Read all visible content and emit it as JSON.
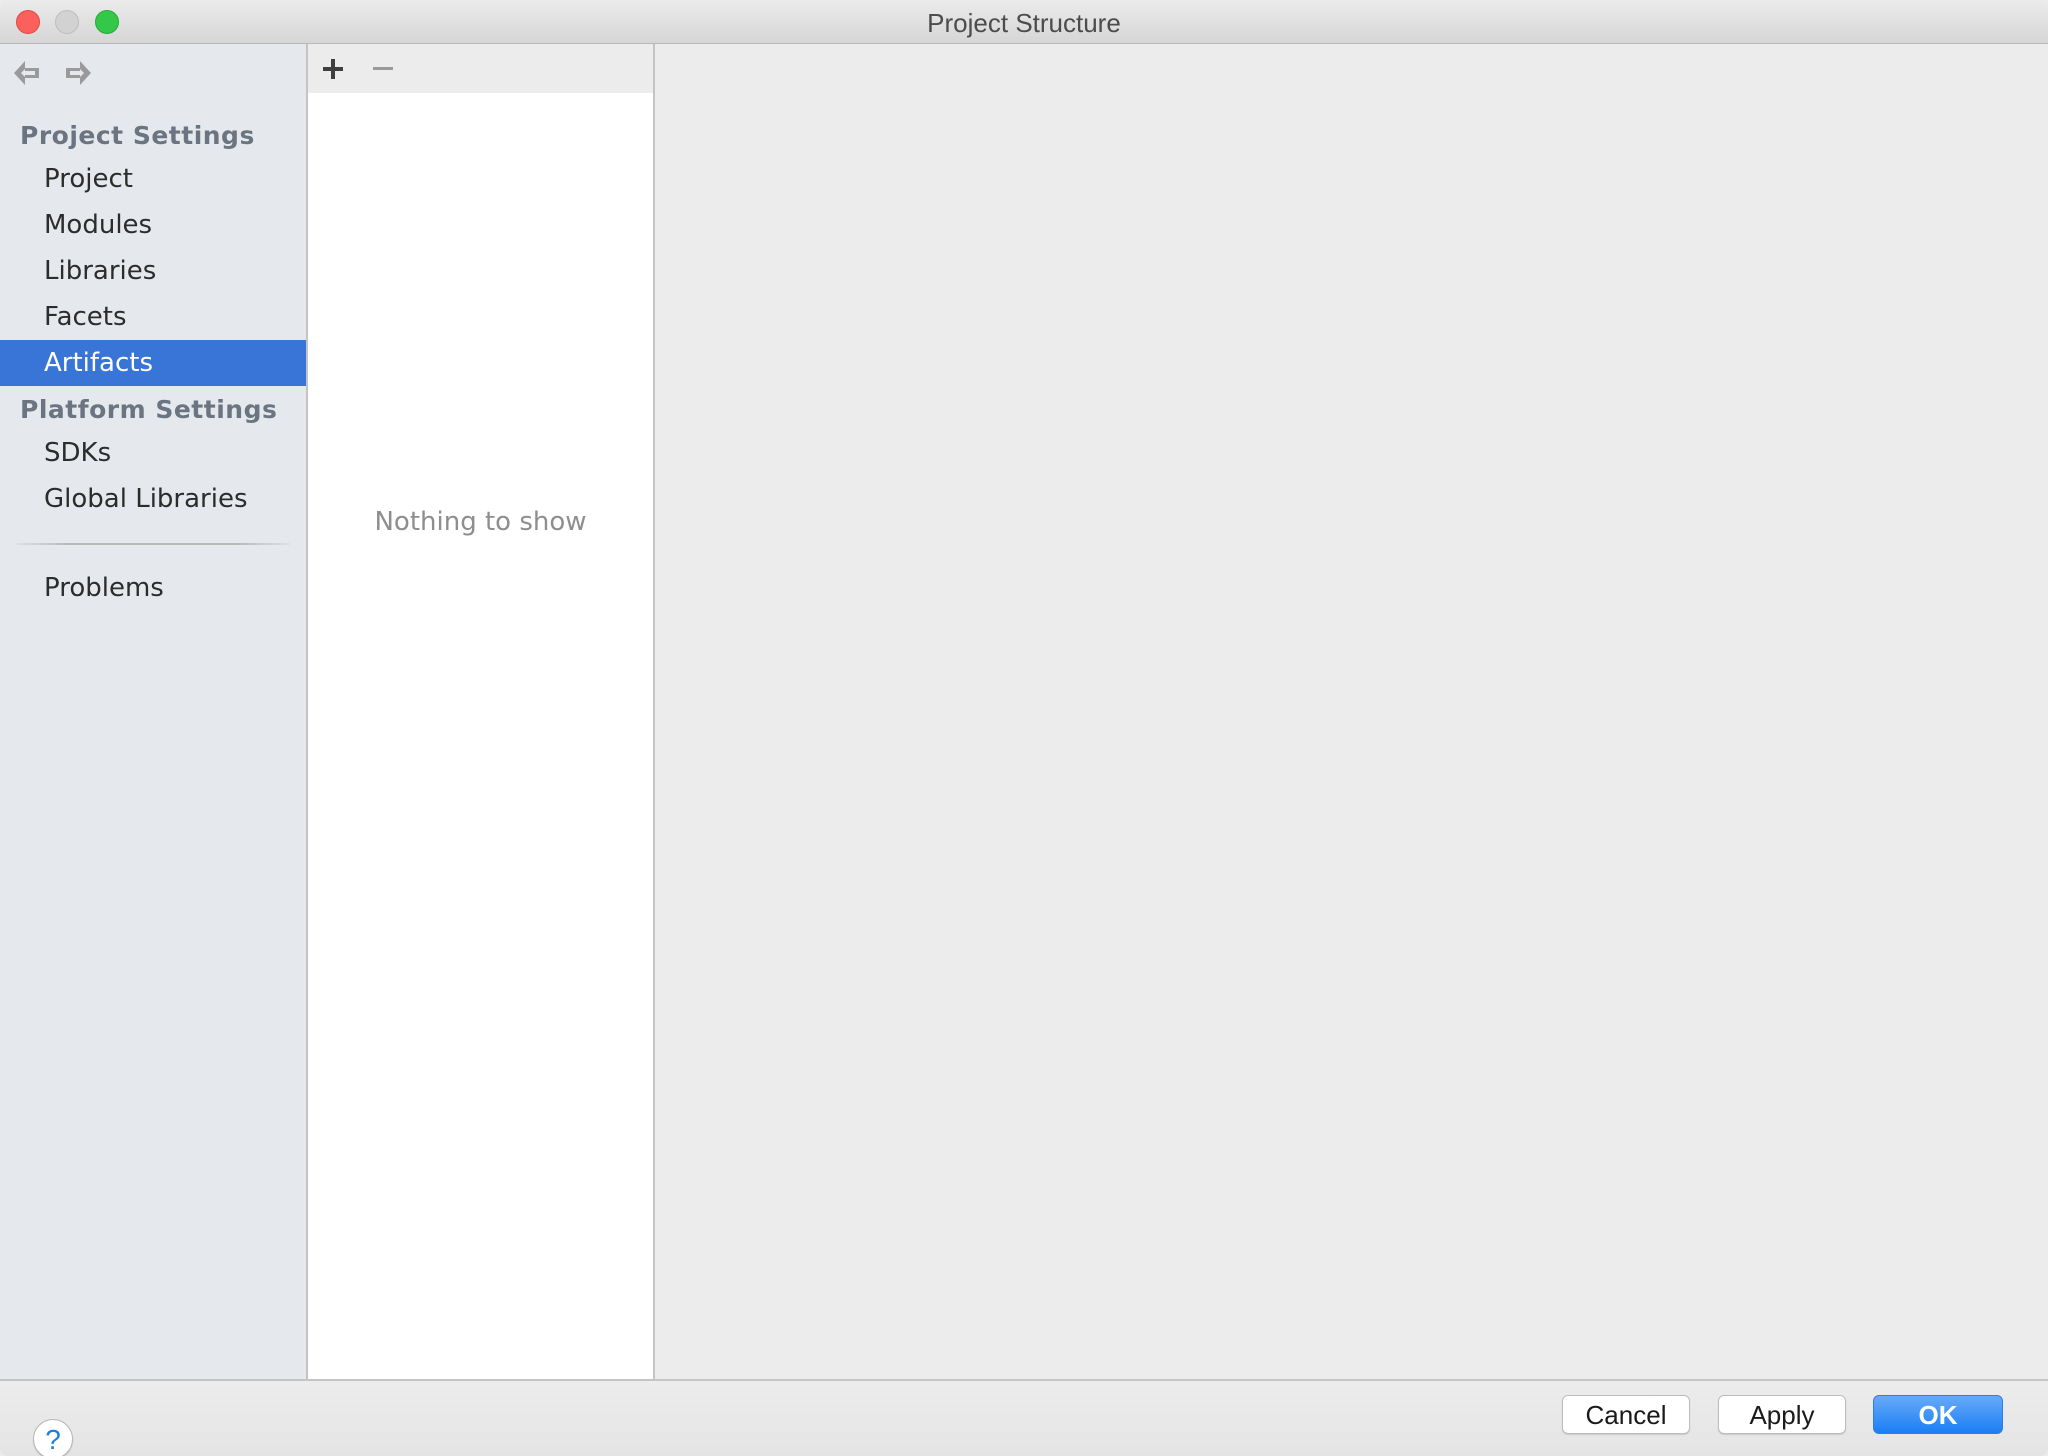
{
  "window": {
    "title": "Project Structure"
  },
  "titlebar_controls": [
    "close",
    "minimize",
    "maximize"
  ],
  "sidebar": {
    "nav": {
      "back_icon": "arrow-left-icon",
      "forward_icon": "arrow-right-icon"
    },
    "sections": [
      {
        "title": "Project Settings",
        "items": [
          {
            "label": "Project",
            "selected": false
          },
          {
            "label": "Modules",
            "selected": false
          },
          {
            "label": "Libraries",
            "selected": false
          },
          {
            "label": "Facets",
            "selected": false
          },
          {
            "label": "Artifacts",
            "selected": true
          }
        ]
      },
      {
        "title": "Platform Settings",
        "items": [
          {
            "label": "SDKs",
            "selected": false
          },
          {
            "label": "Global Libraries",
            "selected": false
          }
        ]
      }
    ],
    "footer_items": [
      {
        "label": "Problems",
        "selected": false
      }
    ]
  },
  "list_panel": {
    "toolbar": {
      "add_icon": "plus-icon",
      "remove_icon": "minus-icon"
    },
    "empty_text": "Nothing to show"
  },
  "footer": {
    "help_label": "?",
    "cancel_label": "Cancel",
    "apply_label": "Apply",
    "ok_label": "OK"
  },
  "colors": {
    "selection": "#3875d7",
    "primary_button": "#1a7ef5",
    "sidebar_bg": "#e5e9ee",
    "section_header": "#6a7581"
  }
}
